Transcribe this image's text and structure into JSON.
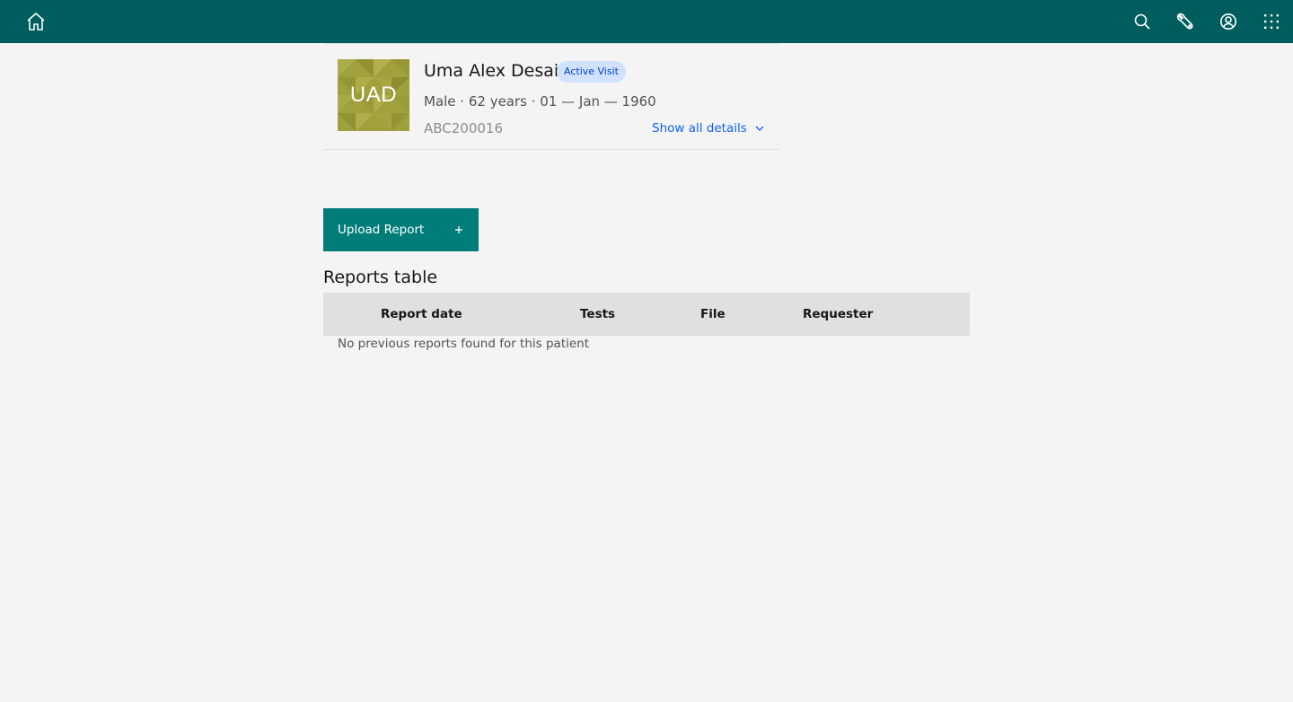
{
  "topbar": {
    "background": "#005d5d",
    "icons": [
      "home-icon",
      "search-icon",
      "tools-icon",
      "user-avatar-icon",
      "app-switcher-icon"
    ]
  },
  "patient": {
    "initials": "UAD",
    "name": "Uma Alex Desai",
    "visit_status": "Active Visit",
    "demographics": "Male · 62 years · 01 — Jan — 1960",
    "identifier": "ABC200016",
    "show_details_label": "Show all details"
  },
  "actions": {
    "upload_label": "Upload Report"
  },
  "reports_table": {
    "title": "Reports table",
    "columns": [
      "Report date",
      "Tests",
      "File",
      "Requester"
    ],
    "empty_message": "No previous reports found for this patient"
  }
}
